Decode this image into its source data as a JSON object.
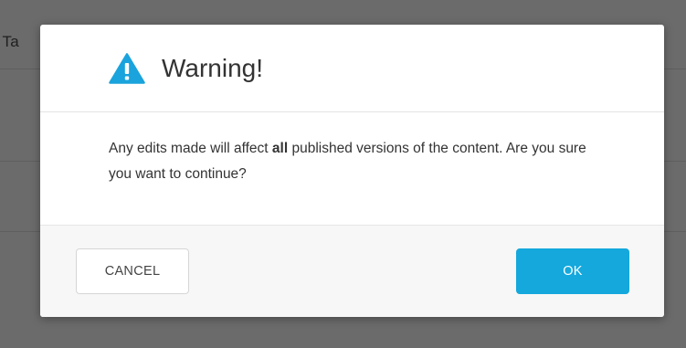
{
  "background": {
    "partial_text": "f Ta"
  },
  "dialog": {
    "icon": "warning-triangle-icon",
    "icon_color": "#1aa3dc",
    "title": "Warning!",
    "message_before": "Any edits made will affect ",
    "message_bold": "all",
    "message_after": " published versions of the content. Are you sure you want to continue?",
    "cancel_label": "CANCEL",
    "ok_label": "OK",
    "ok_color": "#14a8dd"
  }
}
